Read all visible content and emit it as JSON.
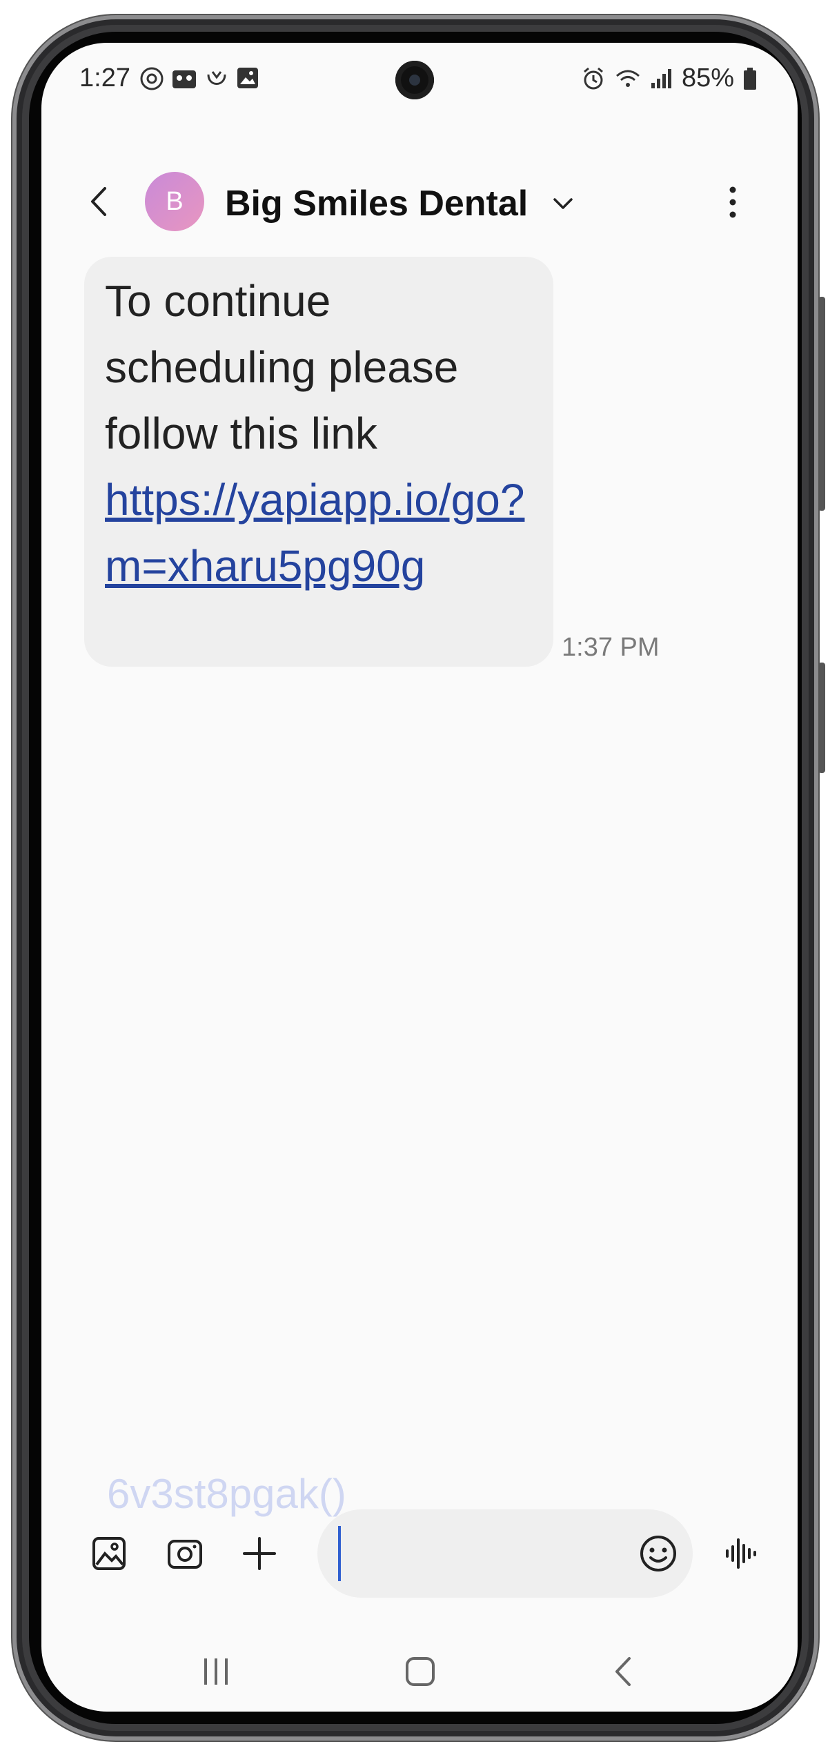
{
  "status_bar": {
    "time": "1:27",
    "battery_percent": "85%",
    "left_icons": [
      "threads-icon",
      "voicemail-icon",
      "app-icon",
      "image-icon"
    ],
    "right_icons": [
      "alarm-icon",
      "wifi-icon",
      "signal-icon",
      "battery-icon"
    ]
  },
  "header": {
    "avatar_initial": "B",
    "contact_name": "Big Smiles Dental"
  },
  "message": {
    "text_before_link": "To continue scheduling please follow this link ",
    "link_text": "https://yapiapp.io/go?m=xharu5pg90g",
    "timestamp": "1:37 PM"
  },
  "ghost_text": "6v3st8pgak()",
  "composer": {
    "input_value": ""
  },
  "colors": {
    "link": "#24439e",
    "bubble": "#efefef",
    "cursor": "#2f5fd0",
    "avatar_gradient": [
      "#c98ad8",
      "#e896c0"
    ]
  }
}
